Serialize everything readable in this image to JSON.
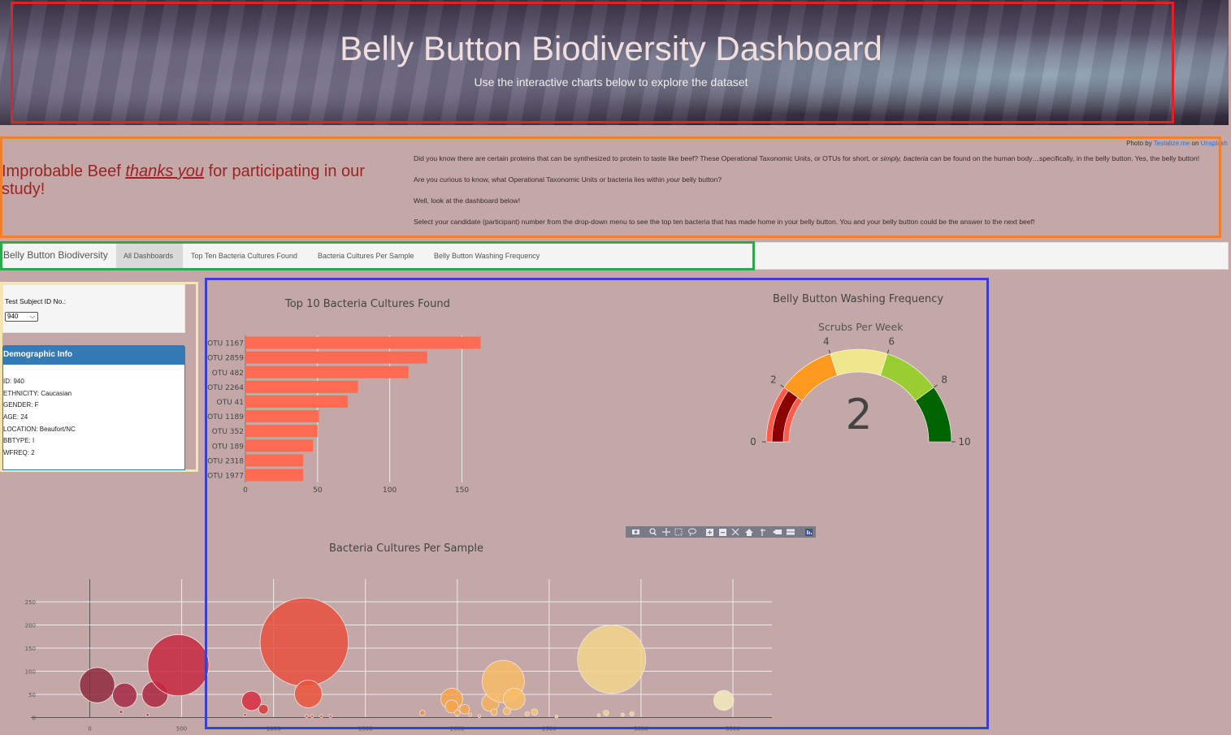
{
  "header": {
    "title": "Belly Button Biodiversity Dashboard",
    "subtitle": "Use the interactive charts below to explore the dataset"
  },
  "credit": {
    "prefix": "Photo by",
    "author": "Testalize.me",
    "on": "on",
    "site": "Unsplash"
  },
  "intro": {
    "thanks_before": "Improbable Beef",
    "thanks_em": "thanks you",
    "thanks_after": "for participating in our study!",
    "p1a": "Did you know there are certain proteins that can be synthesized to protein to taste like beef? These Operational Taxonomic Units, or OTUs for short, or",
    "p1b": "simply, bacteria",
    "p1c": "can be found on the human body…specifically, in the belly button. Yes, the belly button!",
    "p2a": "Are you curious to know, what Operational Taxonomic Units or bacteria lies within",
    "p2b": "your",
    "p2c": "belly button?",
    "p3": "Well, look at the dashboard below!",
    "p4": "Select your candidate (participant) number from the drop-down menu to see the top ten bacteria that has made home in your belly button. You and your belly button could be the answer to the next beef!"
  },
  "navbar": {
    "brand": "Belly Button Biodiversity",
    "items": [
      "All Dashboards",
      "Top Ten Bacteria Cultures Found",
      "Bacteria Cultures Per Sample",
      "Belly Button Washing Frequency"
    ]
  },
  "selector": {
    "label": "Test Subject ID No.:",
    "value": "940"
  },
  "demographics": {
    "title": "Demographic Info",
    "lines": [
      "ID: 940",
      "ETHNICITY: Caucasian",
      "GENDER: F",
      "AGE: 24",
      "LOCATION: Beaufort/NC",
      "BBTYPE: I",
      "WFREQ: 2"
    ]
  },
  "colors": {
    "bar": "#ff6b52",
    "nav_frame": "#2ea84a",
    "header_frame": "#e0202a",
    "intro_frame": "#f07f30",
    "charts_frame": "#3b3fd1"
  },
  "icons": [
    "camera-icon",
    "zoom-icon",
    "pan-icon",
    "box-select-icon",
    "lasso-icon",
    "zoom-in-icon",
    "zoom-out-icon",
    "autoscale-icon",
    "reset-axes-icon",
    "spike-lines-icon",
    "hover-closest-icon",
    "hover-compare-icon",
    "plotly-logo-icon"
  ],
  "chart_data": [
    {
      "type": "bar",
      "title": "Top 10 Bacteria Cultures Found",
      "orientation": "horizontal",
      "categories": [
        "OTU 1167",
        "OTU 2859",
        "OTU 482",
        "OTU 2264",
        "OTU 41",
        "OTU 1189",
        "OTU 352",
        "OTU 189",
        "OTU 2318",
        "OTU 1977"
      ],
      "values": [
        163,
        126,
        113,
        78,
        71,
        51,
        50,
        47,
        40,
        40
      ],
      "xlim": [
        0,
        170
      ],
      "xticks": [
        0,
        50,
        100,
        150
      ],
      "grid": true
    },
    {
      "type": "gauge",
      "title": "Belly Button Washing Frequency",
      "subtitle": "Scrubs Per Week",
      "value": 2,
      "range": [
        0,
        10
      ],
      "ticks": [
        0,
        2,
        4,
        6,
        8,
        10
      ],
      "steps": [
        {
          "range": [
            0,
            2
          ],
          "color": "#ff5a4a"
        },
        {
          "range": [
            2,
            4
          ],
          "color": "#ff9920"
        },
        {
          "range": [
            4,
            6
          ],
          "color": "#f0e68c"
        },
        {
          "range": [
            6,
            8
          ],
          "color": "#9acd32"
        },
        {
          "range": [
            8,
            10
          ],
          "color": "#006400"
        }
      ],
      "bar_color": "#8b0000"
    },
    {
      "type": "scatter",
      "title": "Bacteria Cultures Per Sample",
      "xticks": [
        0,
        500,
        1000,
        1500,
        2000,
        2500,
        3000,
        3500
      ],
      "yticks": [
        0,
        50,
        100,
        150,
        200,
        250
      ],
      "xlim": [
        -280,
        3800
      ],
      "ylim": [
        -5,
        300
      ],
      "grid": true,
      "points": [
        {
          "x": 40,
          "y": 70,
          "size": 65,
          "color": "#8e2a3e"
        },
        {
          "x": 190,
          "y": 48,
          "size": 45,
          "color": "#a32a46"
        },
        {
          "x": 355,
          "y": 50,
          "size": 48,
          "color": "#ac2842"
        },
        {
          "x": 482,
          "y": 113,
          "size": 113,
          "color": "#c8283f"
        },
        {
          "x": 170,
          "y": 12,
          "size": 6,
          "color": "#b02a40"
        },
        {
          "x": 315,
          "y": 6,
          "size": 4,
          "color": "#b02a40"
        },
        {
          "x": 880,
          "y": 36,
          "size": 36,
          "color": "#d72e3f"
        },
        {
          "x": 945,
          "y": 18,
          "size": 18,
          "color": "#d83a3a"
        },
        {
          "x": 845,
          "y": 6,
          "size": 4,
          "color": "#d83a3a"
        },
        {
          "x": 1167,
          "y": 163,
          "size": 163,
          "color": "#e9503f"
        },
        {
          "x": 1189,
          "y": 51,
          "size": 51,
          "color": "#ea553c"
        },
        {
          "x": 1180,
          "y": 3,
          "size": 4,
          "color": "#ea553c"
        },
        {
          "x": 1210,
          "y": 3,
          "size": 4,
          "color": "#ea553c"
        },
        {
          "x": 1260,
          "y": 3,
          "size": 3,
          "color": "#ea553c"
        },
        {
          "x": 1310,
          "y": 3,
          "size": 3,
          "color": "#ea553c"
        },
        {
          "x": 1810,
          "y": 10,
          "size": 10,
          "color": "#f2903c"
        },
        {
          "x": 1970,
          "y": 40,
          "size": 40,
          "color": "#f4a64c"
        },
        {
          "x": 1970,
          "y": 24,
          "size": 24,
          "color": "#f4a64c"
        },
        {
          "x": 2000,
          "y": 10,
          "size": 10,
          "color": "#f4a64c"
        },
        {
          "x": 2040,
          "y": 18,
          "size": 18,
          "color": "#f4a64c"
        },
        {
          "x": 2070,
          "y": 6,
          "size": 6,
          "color": "#f4a64c"
        },
        {
          "x": 2120,
          "y": 3,
          "size": 4,
          "color": "#f4a64c"
        },
        {
          "x": 2180,
          "y": 32,
          "size": 32,
          "color": "#f6b05a"
        },
        {
          "x": 2200,
          "y": 12,
          "size": 12,
          "color": "#f6b05a"
        },
        {
          "x": 2250,
          "y": 78,
          "size": 78,
          "color": "#f7bc68"
        },
        {
          "x": 2270,
          "y": 14,
          "size": 14,
          "color": "#f7bc68"
        },
        {
          "x": 2310,
          "y": 40,
          "size": 40,
          "color": "#f7bc68"
        },
        {
          "x": 2380,
          "y": 8,
          "size": 8,
          "color": "#f7c470"
        },
        {
          "x": 2420,
          "y": 12,
          "size": 12,
          "color": "#f7c470"
        },
        {
          "x": 2540,
          "y": 2,
          "size": 3,
          "color": "#f7c470"
        },
        {
          "x": 2770,
          "y": 5,
          "size": 5,
          "color": "#f3d388"
        },
        {
          "x": 2810,
          "y": 10,
          "size": 10,
          "color": "#f3d388"
        },
        {
          "x": 2840,
          "y": 126,
          "size": 126,
          "color": "#f2d68c"
        },
        {
          "x": 2900,
          "y": 6,
          "size": 6,
          "color": "#f2d68c"
        },
        {
          "x": 2950,
          "y": 8,
          "size": 8,
          "color": "#f2d68c"
        },
        {
          "x": 3450,
          "y": 37,
          "size": 37,
          "color": "#f3ebbc"
        }
      ]
    }
  ]
}
